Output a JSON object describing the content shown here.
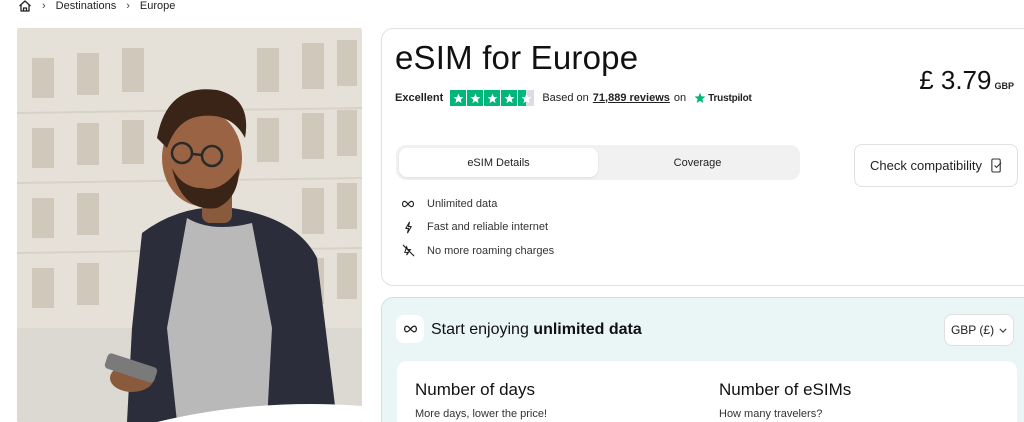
{
  "breadcrumb": {
    "items": [
      "Destinations",
      "Europe"
    ]
  },
  "product": {
    "title": "eSIM for Europe",
    "price_amount": "£ 3.79",
    "price_currency": "GBP"
  },
  "rating": {
    "label": "Excellent",
    "stars": 4.5,
    "based_on": "Based on",
    "reviews_link": "71,889 reviews",
    "on": "on",
    "provider": "Trustpilot"
  },
  "tabs": [
    {
      "label": "eSIM Details",
      "active": true
    },
    {
      "label": "Coverage",
      "active": false
    }
  ],
  "compatibility_button": "Check compatibility",
  "features": [
    {
      "icon": "infinity-icon",
      "label": "Unlimited data"
    },
    {
      "icon": "lightning-icon",
      "label": "Fast and reliable internet"
    },
    {
      "icon": "no-roaming-icon",
      "label": "No more roaming charges"
    }
  ],
  "plan": {
    "heading_prefix": "Start enjoying",
    "heading_bold": "unlimited data",
    "currency_selector": "GBP (£)",
    "days_title": "Number of days",
    "days_subtitle": "More days, lower the price!",
    "esims_title": "Number of eSIMs",
    "esims_subtitle": "How many travelers?"
  },
  "colors": {
    "trustpilot_green": "#00b67a",
    "plan_background": "#eaf6f6",
    "plan_border": "#c7e7dc"
  }
}
